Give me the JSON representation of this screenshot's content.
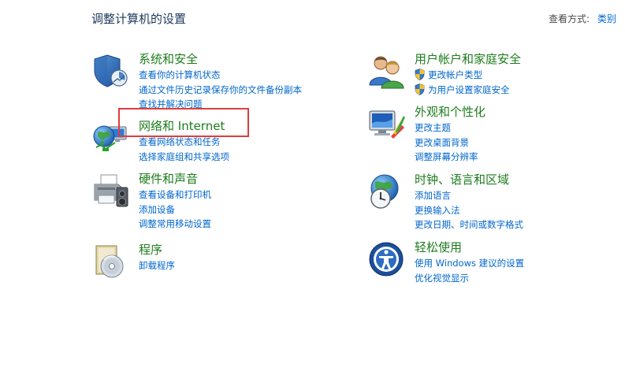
{
  "header": {
    "title": "调整计算机的设置",
    "view_by_label": "查看方式:",
    "view_by_value": "类别"
  },
  "categories": [
    {
      "title": "系统和安全",
      "icon": "shield-security-icon",
      "links": [
        "查看你的计算机状态",
        "通过文件历史记录保存你的文件备份副本",
        "查找并解决问题"
      ]
    },
    {
      "title": "网络和 Internet",
      "icon": "network-globe-icon",
      "links": [
        "查看网络状态和任务",
        "选择家庭组和共享选项"
      ]
    },
    {
      "title": "硬件和声音",
      "icon": "printer-hardware-icon",
      "links": [
        "查看设备和打印机",
        "添加设备",
        "调整常用移动设置"
      ]
    },
    {
      "title": "程序",
      "icon": "programs-disc-icon",
      "links": [
        "卸载程序"
      ]
    },
    {
      "title": "用户帐户和家庭安全",
      "icon": "users-icon",
      "links": [
        "更改帐户类型",
        "为用户设置家庭安全"
      ]
    },
    {
      "title": "外观和个性化",
      "icon": "appearance-monitor-icon",
      "links": [
        "更改主题",
        "更改桌面背景",
        "调整屏幕分辨率"
      ]
    },
    {
      "title": "时钟、语言和区域",
      "icon": "clock-globe-icon",
      "links": [
        "添加语言",
        "更换输入法",
        "更改日期、时间或数字格式"
      ]
    },
    {
      "title": "轻松使用",
      "icon": "ease-of-access-icon",
      "links": [
        "使用 Windows 建议的设置",
        "优化视觉显示"
      ]
    }
  ],
  "colors": {
    "title_green": "#1e7c1e",
    "link_blue": "#0066cc",
    "highlight_red": "#e03c3c"
  }
}
